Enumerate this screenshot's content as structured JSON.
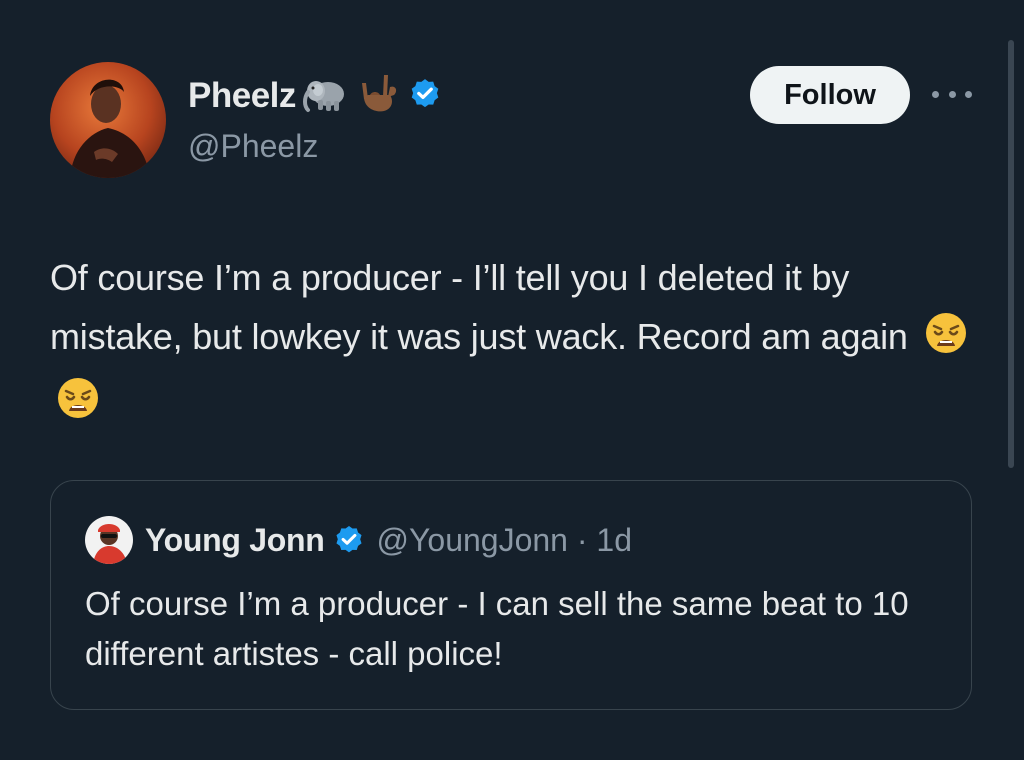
{
  "tweet": {
    "display_name": "Pheelz",
    "handle": "@Pheelz",
    "name_emojis": [
      "elephant-icon",
      "love-you-gesture-icon"
    ],
    "verified": true,
    "follow_label": "Follow",
    "text": "Of course I’m a producer - I’ll tell you I deleted it by mistake, but lowkey it was just wack. Record am again",
    "text_emojis": [
      "weary-face-icon",
      "weary-face-icon"
    ]
  },
  "quote": {
    "display_name": "Young Jonn",
    "handle_and_time": "@YoungJonn · 1d",
    "verified": true,
    "text": "Of course I’m a producer - I can sell the same beat to 10 different artistes - call police!"
  },
  "colors": {
    "background": "#15202b",
    "text_primary": "#e7e9ea",
    "text_secondary": "#8b98a5",
    "verified_blue": "#1d9bf0",
    "border": "#38444d",
    "follow_bg": "#eff3f4"
  }
}
